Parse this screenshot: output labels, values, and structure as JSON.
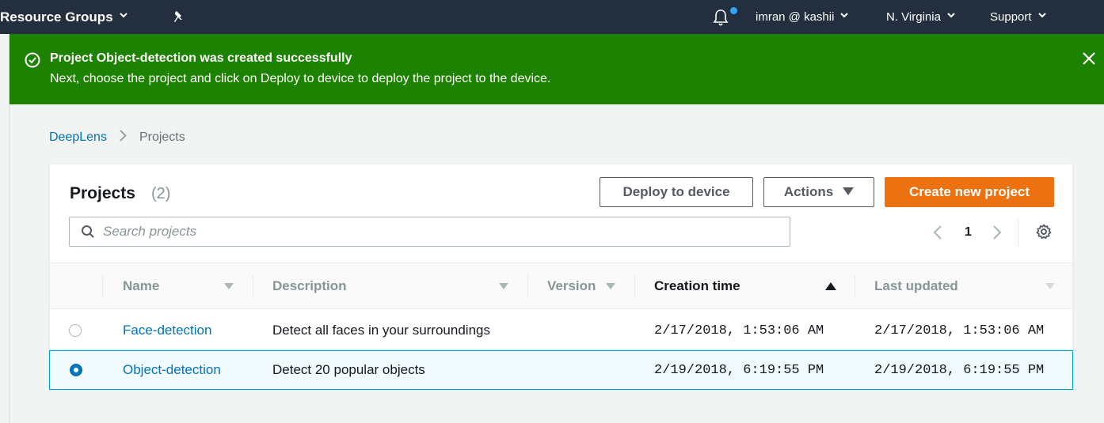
{
  "nav": {
    "resource_groups": "Resource Groups",
    "user": "imran @ kashii",
    "region": "N. Virginia",
    "support": "Support"
  },
  "flash": {
    "title": "Project Object-detection was created successfully",
    "message": "Next, choose the project and click on Deploy to device to deploy the project to the device."
  },
  "breadcrumb": {
    "root": "DeepLens",
    "current": "Projects"
  },
  "panel": {
    "title": "Projects",
    "count": "(2)",
    "deploy_label": "Deploy to device",
    "actions_label": "Actions",
    "create_label": "Create new project",
    "search_placeholder": "Search projects",
    "page": "1"
  },
  "table": {
    "columns": [
      "Name",
      "Description",
      "Version",
      "Creation time",
      "Last updated"
    ],
    "rows": [
      {
        "name": "Face-detection",
        "description": "Detect all faces in your surroundings",
        "version": "",
        "created": "2/17/2018, 1:53:06 AM",
        "updated": "2/17/2018, 1:53:06 AM",
        "selected": false
      },
      {
        "name": "Object-detection",
        "description": "Detect 20 popular objects",
        "version": "",
        "created": "2/19/2018, 6:19:55 PM",
        "updated": "2/19/2018, 6:19:55 PM",
        "selected": true
      }
    ]
  },
  "colors": {
    "nav_bg": "#232f3e",
    "success": "#1d8102",
    "primary": "#ec7211",
    "link": "#0073bb"
  }
}
